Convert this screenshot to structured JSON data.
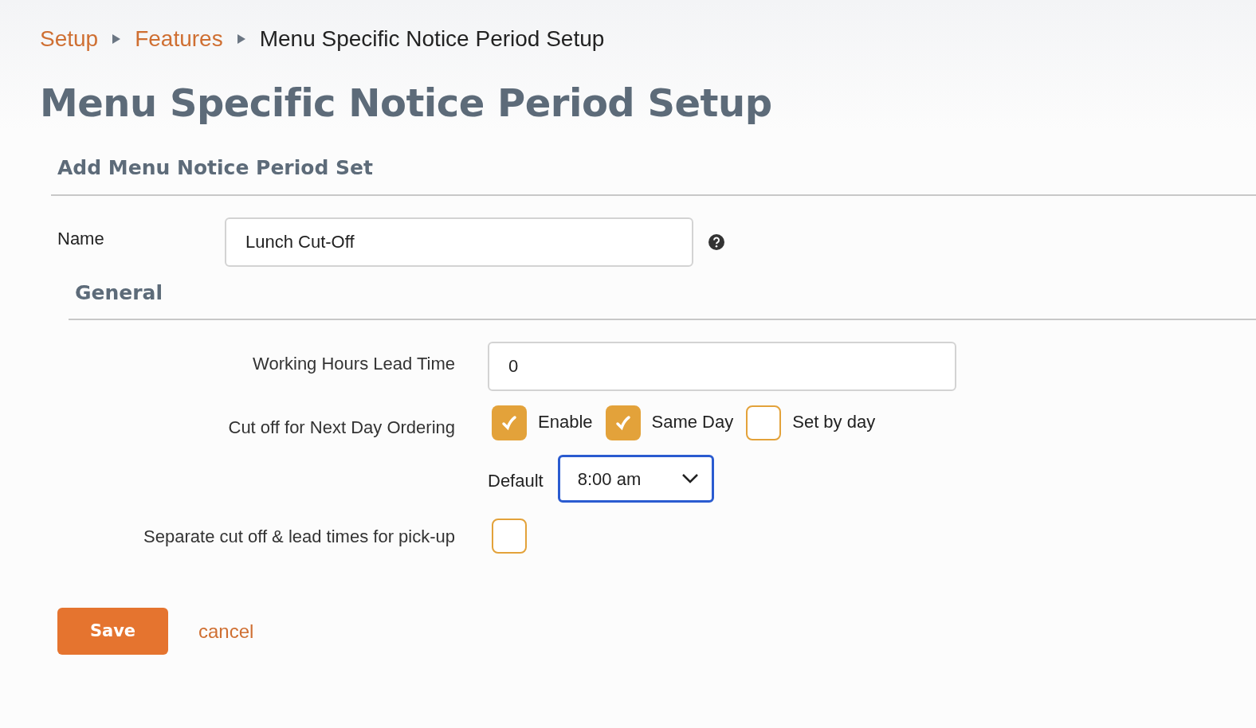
{
  "breadcrumb": [
    {
      "label": "Setup",
      "link": true
    },
    {
      "label": "Features",
      "link": true
    },
    {
      "label": "Menu Specific Notice Period Setup",
      "link": false
    }
  ],
  "title": "Menu Specific Notice Period Setup",
  "section": "Add Menu Notice Period Set",
  "name_field": {
    "label": "Name",
    "value": "Lunch Cut-Off"
  },
  "general": {
    "heading": "General",
    "lead_time": {
      "label": "Working Hours Lead Time",
      "value": "0"
    },
    "cut_off": {
      "label": "Cut off for Next Day Ordering",
      "options": [
        {
          "label": "Enable",
          "checked": true
        },
        {
          "label": "Same Day",
          "checked": true
        },
        {
          "label": "Set by day",
          "checked": false
        }
      ],
      "default_label": "Default",
      "default_value": "8:00 am"
    },
    "separate": {
      "label": "Separate cut off & lead times for pick-up",
      "checked": false
    }
  },
  "buttons": {
    "save": "Save",
    "cancel": "cancel"
  }
}
